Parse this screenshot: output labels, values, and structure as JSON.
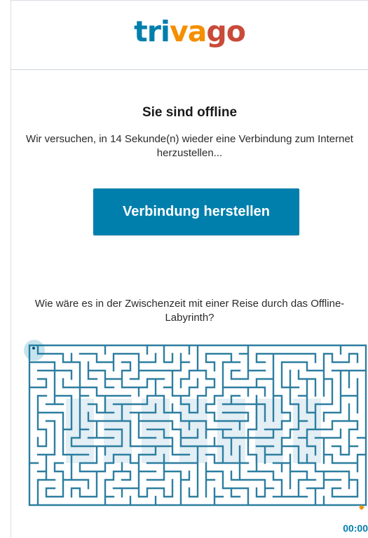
{
  "header": {
    "logo": {
      "part_tri": "tri",
      "part_va": "va",
      "part_go": "go"
    }
  },
  "offline": {
    "title": "Sie sind offline",
    "message": "Wir versuchen, in 14 Sekunde(n) wieder eine Verbindung zum Internet herzustellen...",
    "button_label": "Verbindung herstellen"
  },
  "maze": {
    "intro": "Wie wäre es in der Zwischenzeit mit einer Reise durch das Offline-Labyrinth?",
    "word": "OFFLINE",
    "timer": "00:00"
  },
  "colors": {
    "brand_blue": "#007fad",
    "brand_orange": "#f48f00",
    "brand_red": "#c94a38",
    "maze_wall": "#2d7ea0",
    "maze_letter_fill": "#e3eff5"
  },
  "icons": {
    "player": "player-dot-icon",
    "goal": "goal-diamond-icon"
  }
}
